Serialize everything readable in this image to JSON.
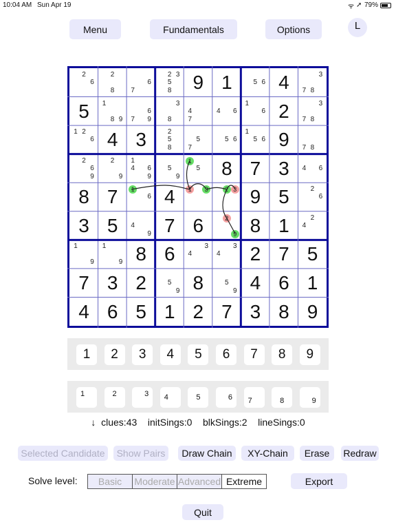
{
  "status_bar": {
    "time": "10:04 AM",
    "date": "Sun Apr 19",
    "battery": "79%",
    "icons": [
      "wifi-icon",
      "location-icon",
      "battery-icon"
    ]
  },
  "header": {
    "menu": "Menu",
    "fundamentals": "Fundamentals",
    "options": "Options",
    "avatar": "L"
  },
  "grid": {
    "rows": [
      [
        [
          2,
          6
        ],
        [
          2,
          8
        ],
        [
          6,
          7
        ],
        [
          2,
          3,
          5,
          8
        ],
        9,
        1,
        [
          5,
          6
        ],
        4,
        [
          3,
          7,
          8
        ]
      ],
      [
        5,
        [
          1,
          8,
          9
        ],
        [
          6,
          7,
          9
        ],
        [
          3,
          8
        ],
        [
          4,
          7
        ],
        [
          4,
          6
        ],
        [
          1,
          6
        ],
        2,
        [
          3,
          7,
          8
        ]
      ],
      [
        [
          1,
          2,
          6
        ],
        4,
        3,
        [
          2,
          5,
          8
        ],
        [
          5,
          7
        ],
        [
          5,
          6
        ],
        [
          1,
          5,
          6
        ],
        9,
        [
          7,
          8
        ]
      ],
      [
        [
          2,
          6,
          9
        ],
        [
          2,
          9
        ],
        [
          1,
          4,
          6,
          9
        ],
        [
          5,
          9
        ],
        [
          1,
          5
        ],
        8,
        7,
        3,
        [
          4,
          6
        ]
      ],
      [
        8,
        7,
        [
          1,
          6
        ],
        4,
        [
          1,
          3
        ],
        [
          2,
          3
        ],
        9,
        5,
        [
          2,
          6
        ]
      ],
      [
        3,
        5,
        [
          4,
          9
        ],
        7,
        6,
        [
          2,
          9
        ],
        8,
        1,
        [
          2,
          4
        ]
      ],
      [
        [
          1,
          9
        ],
        [
          1,
          9
        ],
        8,
        6,
        [
          3,
          4
        ],
        [
          3,
          4
        ],
        2,
        7,
        5
      ],
      [
        7,
        3,
        2,
        [
          5,
          9
        ],
        8,
        [
          5,
          9
        ],
        4,
        6,
        1
      ],
      [
        4,
        6,
        5,
        1,
        2,
        7,
        3,
        8,
        9
      ]
    ],
    "chain_highlights": [
      {
        "row": 4,
        "col": 5,
        "digit": 1,
        "color": "#66dd66"
      },
      {
        "row": 5,
        "col": 3,
        "digit": 1,
        "color": "#66dd66"
      },
      {
        "row": 5,
        "col": 5,
        "digit": 1,
        "color": "#f4a0a0"
      },
      {
        "row": 5,
        "col": 5,
        "digit": 3,
        "color": "#66dd66"
      },
      {
        "row": 5,
        "col": 6,
        "digit": 2,
        "color": "#66dd66"
      },
      {
        "row": 5,
        "col": 6,
        "digit": 3,
        "color": "#f4a0a0"
      },
      {
        "row": 6,
        "col": 6,
        "digit": 2,
        "color": "#f4a0a0"
      },
      {
        "row": 6,
        "col": 6,
        "digit": 9,
        "color": "#66dd66"
      }
    ]
  },
  "number_pad": [
    "1",
    "2",
    "3",
    "4",
    "5",
    "6",
    "7",
    "8",
    "9"
  ],
  "candidate_pad": [
    "1",
    "2",
    "3",
    "4",
    "5",
    "6",
    "7",
    "8",
    "9"
  ],
  "stats": {
    "arrow": "↓",
    "clues": "clues:43",
    "initSings": "initSings:0",
    "blkSings": "blkSings:2",
    "lineSings": "lineSings:0"
  },
  "actions": {
    "selected_candidate": "Selected Candidate",
    "show_pairs": "Show Pairs",
    "draw_chain": "Draw Chain",
    "xy_chain": "XY-Chain",
    "erase": "Erase",
    "redraw": "Redraw"
  },
  "solve_level": {
    "label": "Solve level:",
    "options": [
      "Basic",
      "Moderate",
      "Advanced",
      "Extreme"
    ],
    "selected": "Extreme"
  },
  "export": "Export",
  "quit": "Quit"
}
